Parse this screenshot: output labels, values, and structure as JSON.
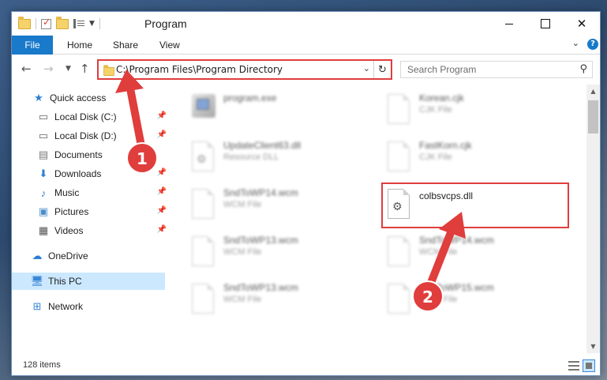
{
  "window": {
    "title": "Program"
  },
  "ribbon": {
    "tabs": [
      "File",
      "Home",
      "Share",
      "View"
    ],
    "help_label": "?"
  },
  "address_bar": {
    "path": "C:\\Program Files\\Program Directory",
    "search_placeholder": "Search Program"
  },
  "nav_pane": {
    "items": [
      {
        "label": "Quick access",
        "icon": "star-icon"
      },
      {
        "label": "Local Disk (C:)",
        "icon": "drive-icon",
        "pinned": true
      },
      {
        "label": "Local Disk (D:)",
        "icon": "drive-icon",
        "pinned": true
      },
      {
        "label": "Documents",
        "icon": "documents-icon",
        "pinned": true
      },
      {
        "label": "Downloads",
        "icon": "download-icon",
        "pinned": true
      },
      {
        "label": "Music",
        "icon": "music-icon",
        "pinned": true
      },
      {
        "label": "Pictures",
        "icon": "pictures-icon",
        "pinned": true
      },
      {
        "label": "Videos",
        "icon": "video-icon",
        "pinned": true
      },
      {
        "label": "OneDrive",
        "icon": "cloud-icon"
      },
      {
        "label": "This PC",
        "icon": "computer-icon",
        "selected": true
      },
      {
        "label": "Network",
        "icon": "network-icon"
      }
    ]
  },
  "files": [
    {
      "name": "program.exe",
      "type": "",
      "icon": "exe-icon"
    },
    {
      "name": "Korean.cjk",
      "type": "CJK File",
      "icon": "document-icon"
    },
    {
      "name": "UpdateClient63.dll",
      "type": "Resource DLL",
      "icon": "gear-document-icon"
    },
    {
      "name": "FastKorn.cjk",
      "type": "CJK File",
      "icon": "document-icon"
    },
    {
      "name": "SndToWP14.wcm",
      "type": "WCM File",
      "icon": "document-icon"
    },
    {
      "name": "colbsvcps.dll",
      "type": "",
      "icon": "gear-document-icon",
      "highlighted": true
    },
    {
      "name": "SndToWP13.wcm",
      "type": "WCM File",
      "icon": "document-icon"
    },
    {
      "name": "SndToWP14.wcm",
      "type": "WCM File",
      "icon": "document-icon"
    },
    {
      "name": "SndToWP13.wcm",
      "type": "WCM File",
      "icon": "document-icon"
    },
    {
      "name": "SndToWP15.wcm",
      "type": "WCM File",
      "icon": "document-icon"
    }
  ],
  "status_bar": {
    "item_count": "128 items"
  },
  "annotations": {
    "step1": "1",
    "step2": "2",
    "color": "#e03d3d"
  }
}
